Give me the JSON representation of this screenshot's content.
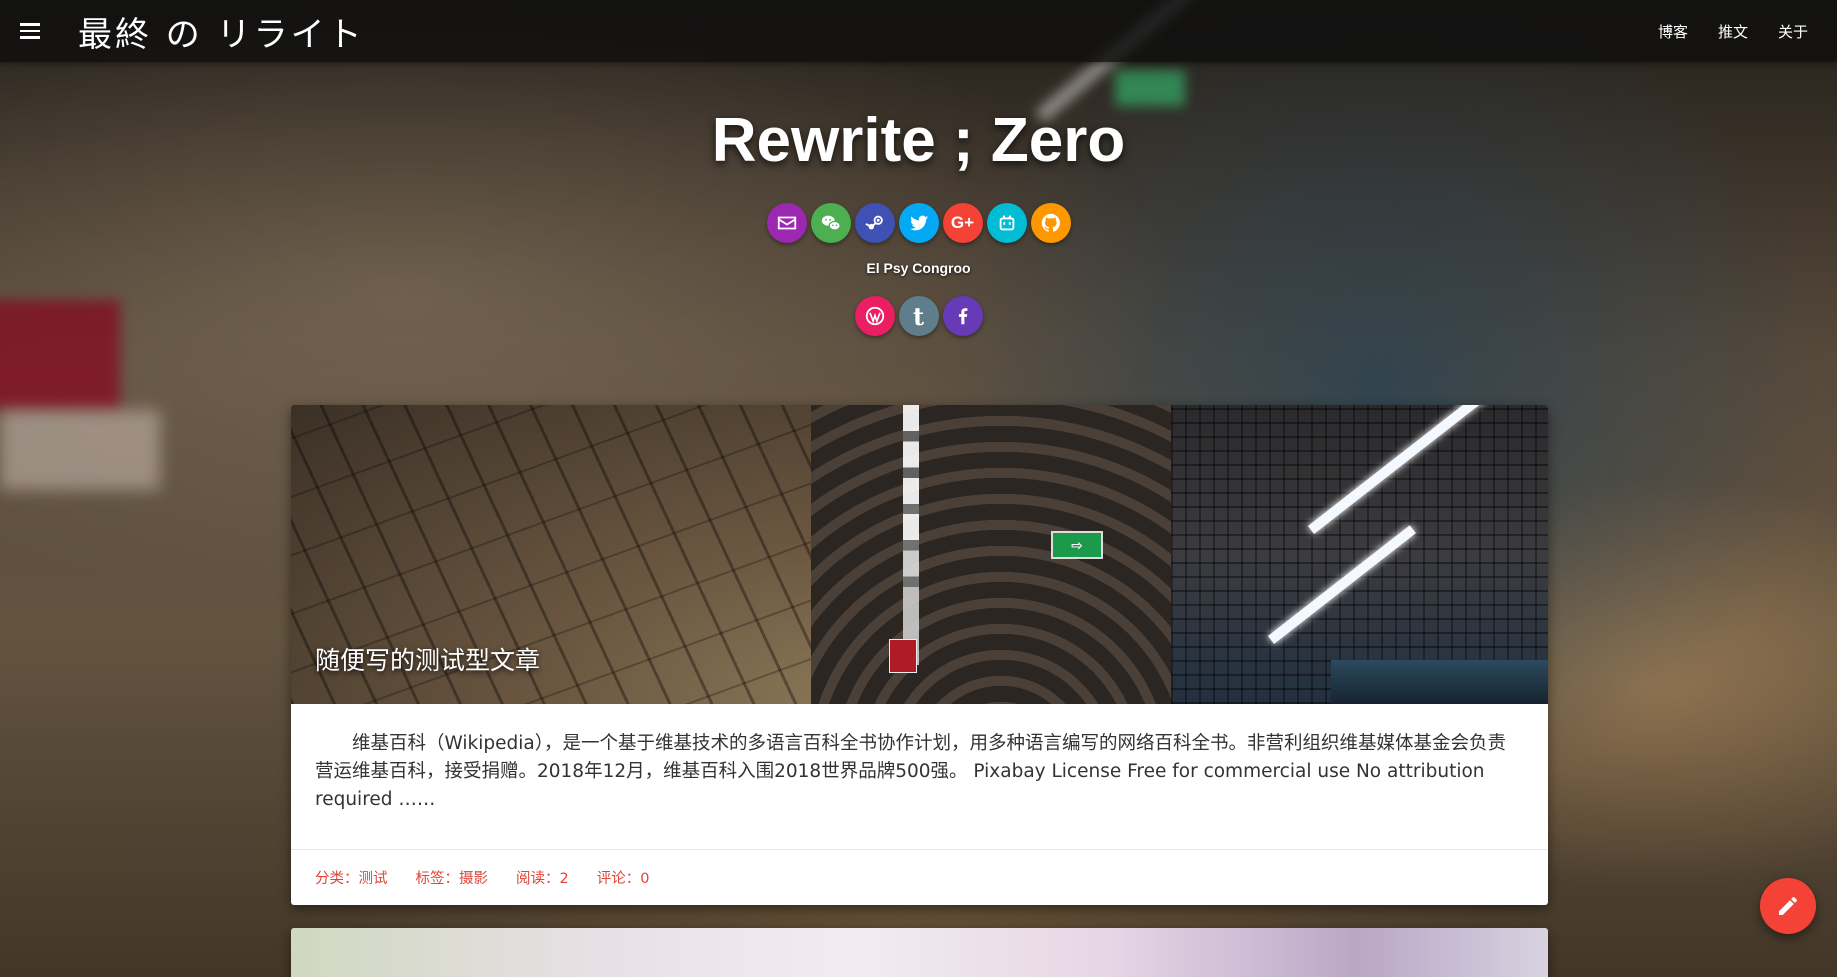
{
  "header": {
    "site_title": "最終 の リライト",
    "nav": [
      "博客",
      "推文",
      "关于"
    ]
  },
  "hero": {
    "title": "Rewrite ; Zero",
    "motto": "El Psy Congroo",
    "social_row1": [
      {
        "icon": "email-icon",
        "color": "#9c27b0"
      },
      {
        "icon": "wechat-icon",
        "color": "#4caf50"
      },
      {
        "icon": "steam-icon",
        "color": "#3f51b5"
      },
      {
        "icon": "twitter-icon",
        "color": "#03a9f4"
      },
      {
        "icon": "google-plus-icon",
        "color": "#f44336"
      },
      {
        "icon": "bilibili-icon",
        "color": "#00bcd4"
      },
      {
        "icon": "github-icon",
        "color": "#ff9800"
      }
    ],
    "social_row2": [
      {
        "icon": "wordpress-icon",
        "color": "#e91e63"
      },
      {
        "icon": "tumblr-icon",
        "color": "#607d8b"
      },
      {
        "icon": "facebook-icon",
        "color": "#673ab7"
      }
    ]
  },
  "post": {
    "title": "随便写的测试型文章",
    "excerpt": "维基百科（Wikipedia），是一个基于维基技术的多语言百科全书协作计划，用多种语言编写的网络百科全书。非营利组织维基媒体基金会负责营运维基百科，接受捐赠。2018年12月，维基百科入围2018世界品牌500强。  Pixabay License Free for commercial use No attribution required ……",
    "exit_sign": "⇨",
    "meta": {
      "category": "分类：测试",
      "tags": "标签：摄影",
      "views": "阅读：2",
      "comments": "评论：0"
    }
  },
  "fab": {
    "icon": "pencil-icon",
    "color": "#f44336"
  }
}
